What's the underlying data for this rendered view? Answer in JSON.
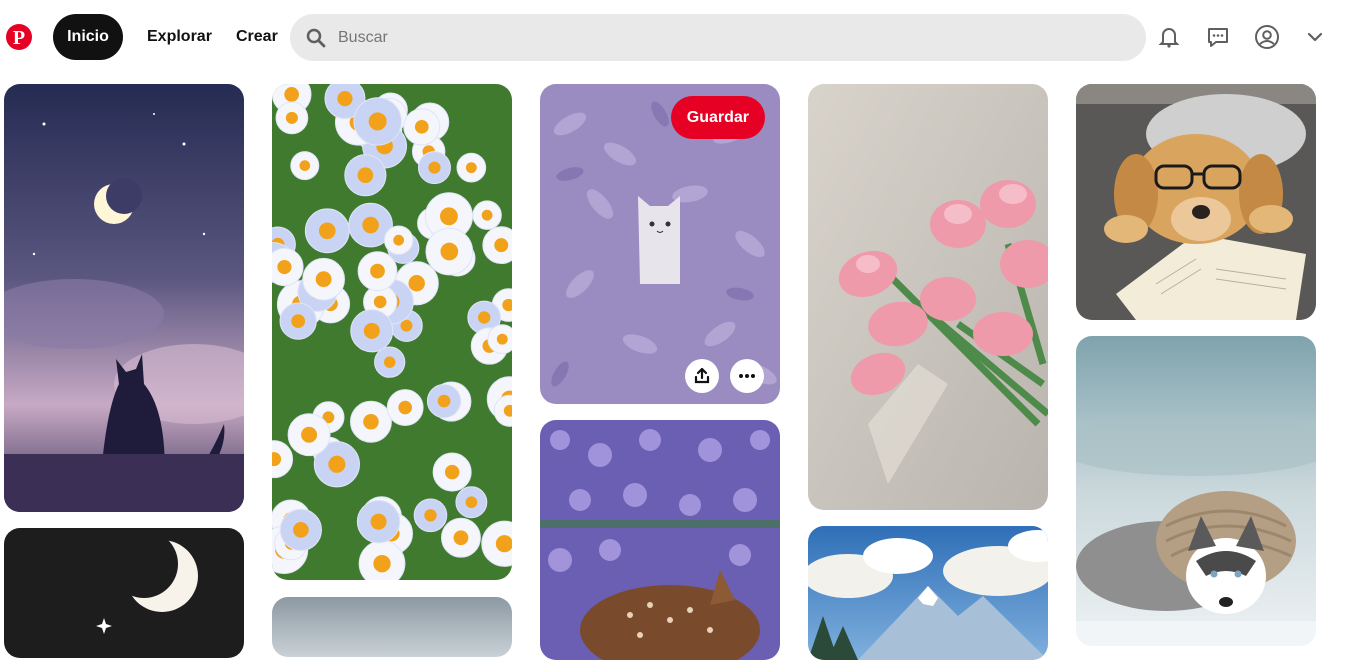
{
  "header": {
    "logo_icon": "pinterest-logo-icon",
    "nav": {
      "home": "Inicio",
      "explore": "Explorar",
      "create": "Crear"
    },
    "search": {
      "placeholder": "Buscar",
      "value": "",
      "icon": "search-icon"
    },
    "icons": [
      "bell-icon",
      "chat-icon",
      "profile-icon",
      "chevron-down-icon"
    ]
  },
  "pin_overlay": {
    "save_label": "Guardar",
    "share_icon": "share-icon",
    "more_icon": "more-icon"
  },
  "pins": [
    {
      "subject": "black cat watching crescent moon",
      "icon": "cat-moon-image"
    },
    {
      "subject": "dark sky with crescent moon",
      "icon": "moon-image"
    },
    {
      "subject": "white daisies",
      "icon": "daisies-image"
    },
    {
      "subject": "pale sky landscape",
      "icon": "sky-image"
    },
    {
      "subject": "cat among lavender leaves",
      "icon": "cat-leaves-image"
    },
    {
      "subject": "purple flowers with fawn",
      "icon": "fawn-flowers-image"
    },
    {
      "subject": "pink tulips bouquet",
      "icon": "tulips-image"
    },
    {
      "subject": "snowy mountains under clouds",
      "icon": "mountains-image"
    },
    {
      "subject": "dog with glasses reading book",
      "icon": "dog-reading-image"
    },
    {
      "subject": "husky in snow",
      "icon": "husky-image"
    }
  ],
  "colors": {
    "brand": "#e60023",
    "nav_active": "#111111",
    "search_bg": "#e9e9e9"
  }
}
